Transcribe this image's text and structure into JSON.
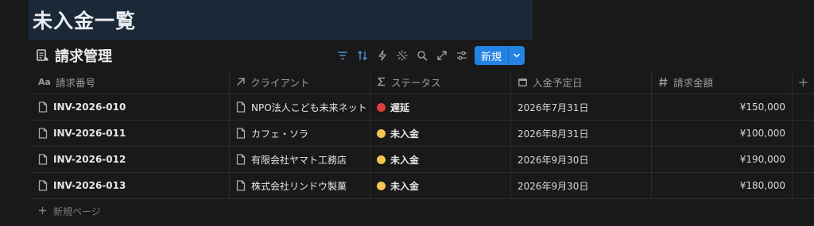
{
  "banner": {
    "title": "未入金一覧"
  },
  "database": {
    "title": "請求管理"
  },
  "toolbar": {
    "icons": [
      "filter-icon",
      "sort-icon",
      "automation-icon",
      "customize-icon",
      "search-icon",
      "expand-icon",
      "settings-icon"
    ],
    "new_label": "新規"
  },
  "table": {
    "columns": [
      {
        "label": "請求番号",
        "icon": "title-icon"
      },
      {
        "label": "クライアント",
        "icon": "relation-icon"
      },
      {
        "label": "ステータス",
        "icon": "formula-icon"
      },
      {
        "label": "入金予定日",
        "icon": "calendar-icon"
      },
      {
        "label": "請求金額",
        "icon": "number-icon"
      }
    ],
    "add_column": "+",
    "rows": [
      {
        "id": "INV-2026-010",
        "client": "NPO法人こども未来ネット",
        "status": "遅延",
        "status_color": "#e03e3e",
        "date": "2026年7月31日",
        "amount": "¥150,000"
      },
      {
        "id": "INV-2026-011",
        "client": "カフェ・ソラ",
        "status": "未入金",
        "status_color": "#f5c451",
        "date": "2026年8月31日",
        "amount": "¥100,000"
      },
      {
        "id": "INV-2026-012",
        "client": "有限会社ヤマト工務店",
        "status": "未入金",
        "status_color": "#f5c451",
        "date": "2026年9月30日",
        "amount": "¥190,000"
      },
      {
        "id": "INV-2026-013",
        "client": "株式会社リンドウ製菓",
        "status": "未入金",
        "status_color": "#f5c451",
        "date": "2026年9月30日",
        "amount": "¥180,000"
      }
    ]
  },
  "new_page_label": "新規ページ",
  "colors": {
    "accent": "#2383e2",
    "background": "#191919",
    "banner": "#1b2837"
  }
}
